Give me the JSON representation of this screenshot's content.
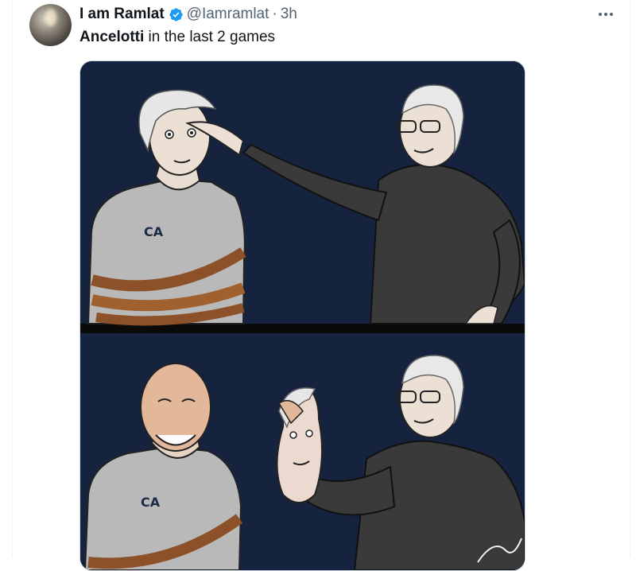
{
  "tweet": {
    "author_name": "I am Ramlat",
    "handle": "@Iamramlat",
    "separator": "·",
    "time": "3h",
    "text_bold": "Ancelotti",
    "text_rest": " in the last 2 games",
    "verified_icon": "verified-badge-icon",
    "more_icon": "more-icon",
    "comic_labels": {
      "shirt_top": "CA",
      "shirt_bottom": "CA"
    },
    "colors": {
      "verified": "#1d9bf0",
      "panel_bg": "#16233f",
      "rope": "#9a5b2e",
      "shirt": "#b8b8b8"
    }
  }
}
